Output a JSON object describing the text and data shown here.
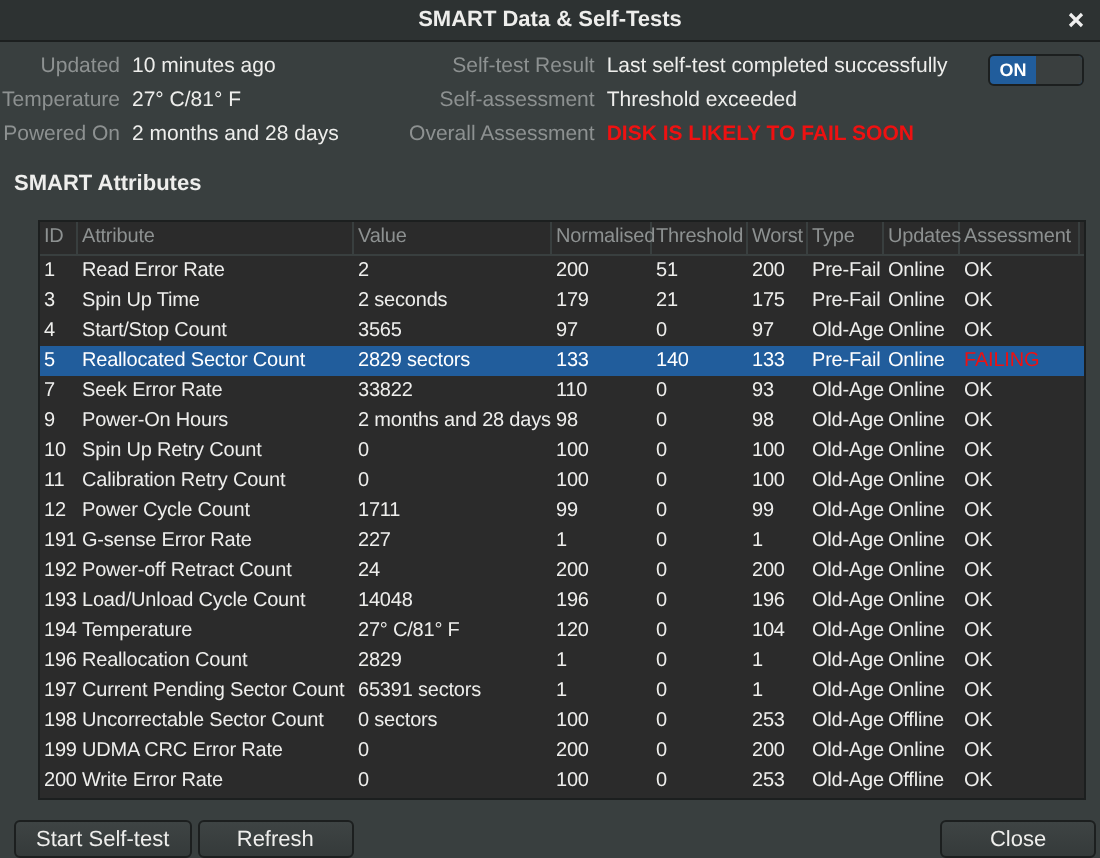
{
  "window": {
    "title": "SMART Data & Self-Tests"
  },
  "info_left": [
    {
      "label": "Updated",
      "value": "10 minutes ago"
    },
    {
      "label": "Temperature",
      "value": "27° C/81° F"
    },
    {
      "label": "Powered On",
      "value": "2 months and 28 days"
    }
  ],
  "info_right": [
    {
      "label": "Self-test Result",
      "value": "Last self-test completed successfully",
      "warning": false
    },
    {
      "label": "Self-assessment",
      "value": "Threshold exceeded",
      "warning": false
    },
    {
      "label": "Overall Assessment",
      "value": "DISK IS LIKELY TO FAIL SOON",
      "warning": true
    }
  ],
  "smart_switch": {
    "label": "ON",
    "on": true
  },
  "section_title": "SMART Attributes",
  "table": {
    "columns": [
      "ID",
      "Attribute",
      "Value",
      "Normalised",
      "Threshold",
      "Worst",
      "Type",
      "Updates",
      "Assessment"
    ],
    "rows": [
      {
        "cells": [
          "1",
          "Read Error Rate",
          "2",
          "200",
          "51",
          "200",
          "Pre-Fail",
          "Online",
          "OK"
        ],
        "selected": false,
        "failing": false
      },
      {
        "cells": [
          "3",
          "Spin Up Time",
          "2 seconds",
          "179",
          "21",
          "175",
          "Pre-Fail",
          "Online",
          "OK"
        ],
        "selected": false,
        "failing": false
      },
      {
        "cells": [
          "4",
          "Start/Stop Count",
          "3565",
          "97",
          "0",
          "97",
          "Old-Age",
          "Online",
          "OK"
        ],
        "selected": false,
        "failing": false
      },
      {
        "cells": [
          "5",
          "Reallocated Sector Count",
          "2829 sectors",
          "133",
          "140",
          "133",
          "Pre-Fail",
          "Online",
          "FAILING"
        ],
        "selected": true,
        "failing": true
      },
      {
        "cells": [
          "7",
          "Seek Error Rate",
          "33822",
          "110",
          "0",
          "93",
          "Old-Age",
          "Online",
          "OK"
        ],
        "selected": false,
        "failing": false
      },
      {
        "cells": [
          "9",
          "Power-On Hours",
          "2 months and 28 days",
          "98",
          "0",
          "98",
          "Old-Age",
          "Online",
          "OK"
        ],
        "selected": false,
        "failing": false
      },
      {
        "cells": [
          "10",
          "Spin Up Retry Count",
          "0",
          "100",
          "0",
          "100",
          "Old-Age",
          "Online",
          "OK"
        ],
        "selected": false,
        "failing": false
      },
      {
        "cells": [
          "11",
          "Calibration Retry Count",
          "0",
          "100",
          "0",
          "100",
          "Old-Age",
          "Online",
          "OK"
        ],
        "selected": false,
        "failing": false
      },
      {
        "cells": [
          "12",
          "Power Cycle Count",
          "1711",
          "99",
          "0",
          "99",
          "Old-Age",
          "Online",
          "OK"
        ],
        "selected": false,
        "failing": false
      },
      {
        "cells": [
          "191",
          "G-sense Error Rate",
          "227",
          "1",
          "0",
          "1",
          "Old-Age",
          "Online",
          "OK"
        ],
        "selected": false,
        "failing": false
      },
      {
        "cells": [
          "192",
          "Power-off Retract Count",
          "24",
          "200",
          "0",
          "200",
          "Old-Age",
          "Online",
          "OK"
        ],
        "selected": false,
        "failing": false
      },
      {
        "cells": [
          "193",
          "Load/Unload Cycle Count",
          "14048",
          "196",
          "0",
          "196",
          "Old-Age",
          "Online",
          "OK"
        ],
        "selected": false,
        "failing": false
      },
      {
        "cells": [
          "194",
          "Temperature",
          "27° C/81° F",
          "120",
          "0",
          "104",
          "Old-Age",
          "Online",
          "OK"
        ],
        "selected": false,
        "failing": false
      },
      {
        "cells": [
          "196",
          "Reallocation Count",
          "2829",
          "1",
          "0",
          "1",
          "Old-Age",
          "Online",
          "OK"
        ],
        "selected": false,
        "failing": false
      },
      {
        "cells": [
          "197",
          "Current Pending Sector Count",
          "65391 sectors",
          "1",
          "0",
          "1",
          "Old-Age",
          "Online",
          "OK"
        ],
        "selected": false,
        "failing": false
      },
      {
        "cells": [
          "198",
          "Uncorrectable Sector Count",
          "0 sectors",
          "100",
          "0",
          "253",
          "Old-Age",
          "Offline",
          "OK"
        ],
        "selected": false,
        "failing": false
      },
      {
        "cells": [
          "199",
          "UDMA CRC Error Rate",
          "0",
          "200",
          "0",
          "200",
          "Old-Age",
          "Online",
          "OK"
        ],
        "selected": false,
        "failing": false
      },
      {
        "cells": [
          "200",
          "Write Error Rate",
          "0",
          "100",
          "0",
          "253",
          "Old-Age",
          "Offline",
          "OK"
        ],
        "selected": false,
        "failing": false
      }
    ]
  },
  "buttons_left": [
    "Start Self-test",
    "Refresh"
  ],
  "buttons_right": [
    "Close"
  ]
}
